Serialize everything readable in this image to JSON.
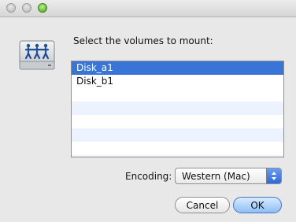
{
  "window": {
    "controls": [
      "close",
      "minimize",
      "zoom"
    ],
    "icon": "network-drive-icon"
  },
  "dialog": {
    "prompt": "Select the volumes to mount:",
    "volumes": [
      {
        "label": "Disk_a1",
        "selected": true
      },
      {
        "label": "Disk_b1",
        "selected": false
      }
    ],
    "encoding_label": "Encoding:",
    "encoding_value": "Western (Mac)",
    "cancel_label": "Cancel",
    "ok_label": "OK"
  },
  "colors": {
    "selection": "#3875d7",
    "alt_row": "#edf3fe",
    "ok_button": "#8dbdf7"
  }
}
